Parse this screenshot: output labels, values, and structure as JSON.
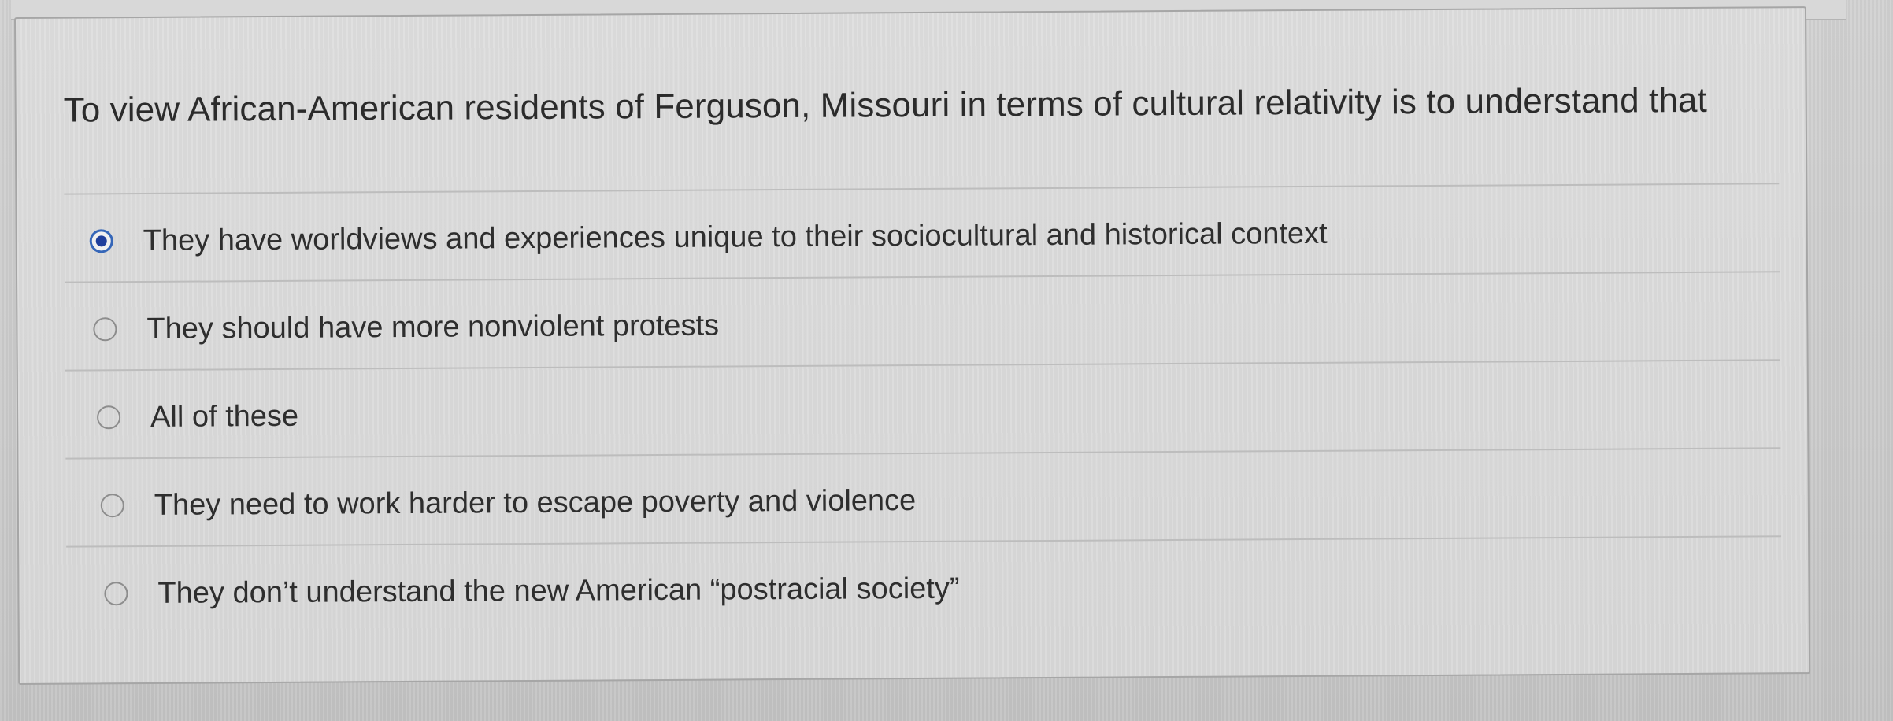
{
  "question": {
    "text": "To view African-American residents of Ferguson, Missouri in terms of cultural relativity is to understand that"
  },
  "choices": [
    {
      "label": "They have worldviews and experiences unique to their sociocultural and historical context",
      "selected": true
    },
    {
      "label": "They should have more nonviolent protests",
      "selected": false
    },
    {
      "label": "All of these",
      "selected": false
    },
    {
      "label": "They need to work harder to escape poverty and violence",
      "selected": false
    },
    {
      "label": "They don’t understand the new American “postracial society”",
      "selected": false
    }
  ],
  "colors": {
    "selected_radio": "#1f3f9c",
    "text": "#2e2e2e"
  }
}
